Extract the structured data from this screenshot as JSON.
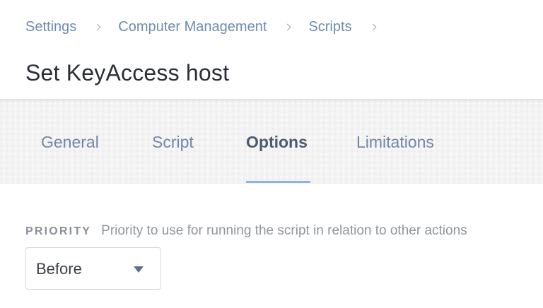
{
  "breadcrumb": {
    "items": [
      "Settings",
      "Computer Management",
      "Scripts"
    ],
    "separator_icon": "chevron-right-icon"
  },
  "page": {
    "title": "Set KeyAccess host"
  },
  "tabs": [
    {
      "label": "General",
      "active": false
    },
    {
      "label": "Script",
      "active": false
    },
    {
      "label": "Options",
      "active": true
    },
    {
      "label": "Limitations",
      "active": false
    }
  ],
  "priority": {
    "label": "PRIORITY",
    "help": "Priority to use for running the script in relation to other actions",
    "selected": "Before",
    "caret_icon": "caret-down-icon"
  },
  "colors": {
    "link": "#6f8bb0",
    "tab_underline": "#8fb3db",
    "title": "#2b2f36"
  }
}
